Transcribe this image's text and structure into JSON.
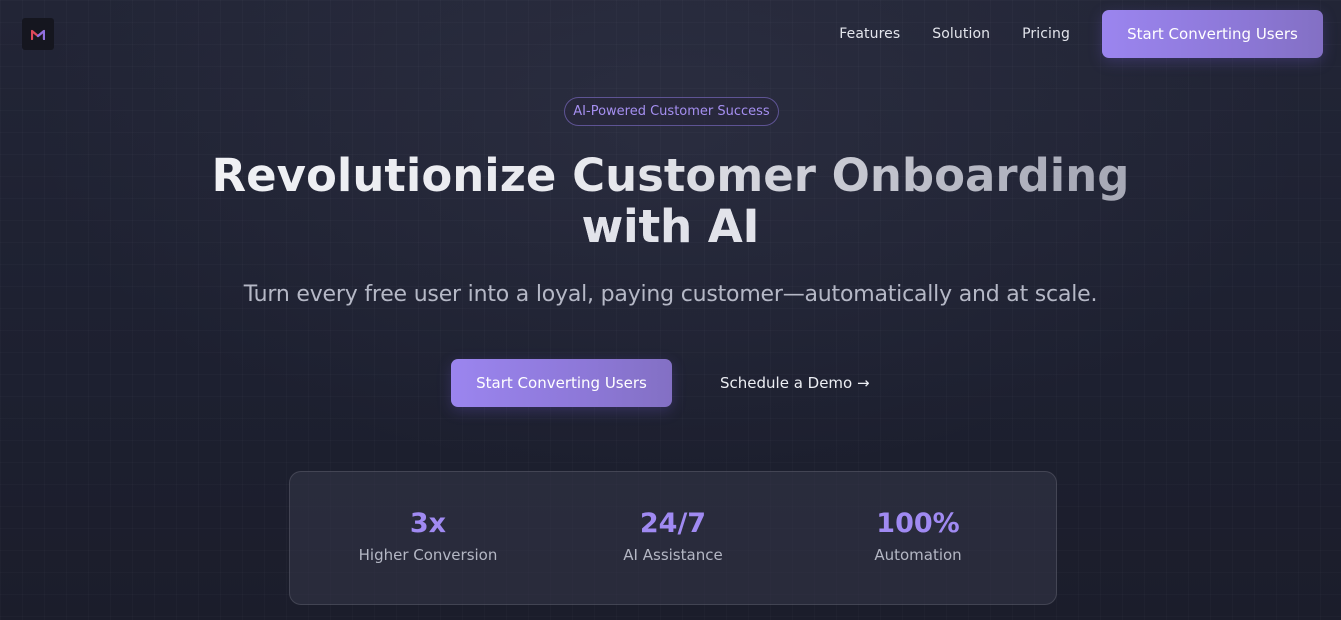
{
  "header": {
    "logo_icon": "m-logo-icon",
    "nav": [
      {
        "label": "Features"
      },
      {
        "label": "Solution"
      },
      {
        "label": "Pricing"
      }
    ],
    "cta_label": "Start Converting Users"
  },
  "hero": {
    "badge": "AI-Powered Customer Success",
    "title_line1": "Revolutionize Customer Onboarding",
    "title_line2": "with AI",
    "subtitle": "Turn every free user into a loyal, paying customer—automatically and at scale.",
    "primary_cta": "Start Converting Users",
    "secondary_cta": "Schedule a Demo →"
  },
  "stats": [
    {
      "value": "3x",
      "label": "Higher Conversion"
    },
    {
      "value": "24/7",
      "label": "AI Assistance"
    },
    {
      "value": "100%",
      "label": "Automation"
    }
  ],
  "colors": {
    "accent": "#9b85ef",
    "background": "#1e2130",
    "stat_value": "#a08af2",
    "logo_red": "#e0485a",
    "logo_purple": "#8f6fe0"
  }
}
